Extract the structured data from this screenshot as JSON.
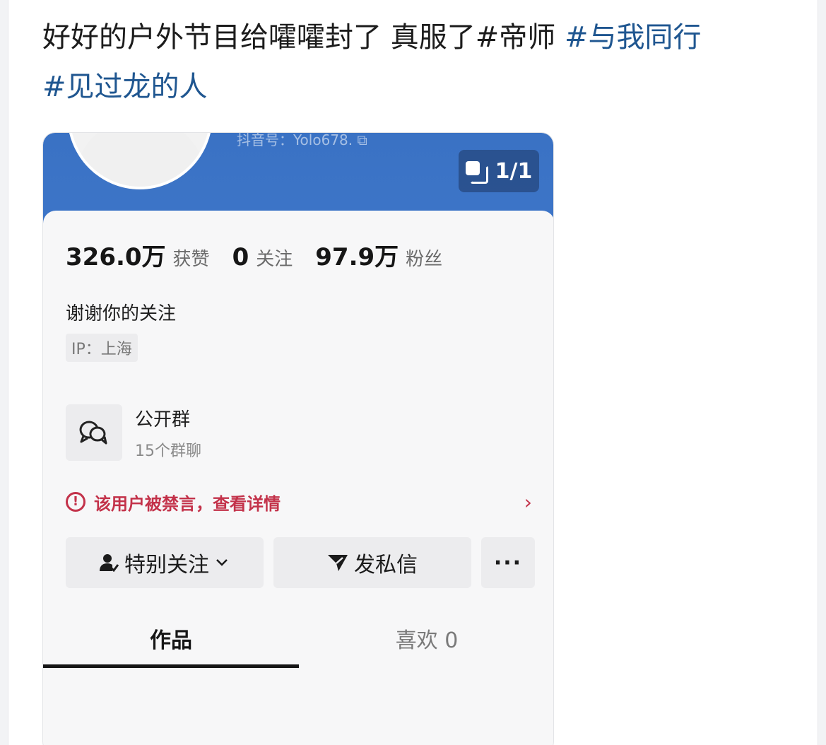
{
  "post": {
    "text_plain": "好好的户外节目给嚯嚯封了 真服了#帝师 ",
    "hashtag_1": "#与我同行",
    "hashtag_2": "#见过龙的人"
  },
  "profile": {
    "douyin_id": "抖音号：Yolo678. ⧉",
    "page_indicator": "1/1",
    "stats": {
      "likes_num": "326.0万",
      "likes_label": "获赞",
      "following_num": "0",
      "following_label": "关注",
      "followers_num": "97.9万",
      "followers_label": "粉丝"
    },
    "bio": "谢谢你的关注",
    "ip": "IP：上海",
    "group": {
      "title": "公开群",
      "subtitle": "15个群聊"
    },
    "ban_notice": "该用户被禁言，查看详情",
    "buttons": {
      "follow": "特别关注",
      "message": "发私信",
      "more": "···"
    },
    "tabs": {
      "works": "作品",
      "likes": "喜欢 0"
    }
  },
  "colors": {
    "header_blue": "#3a72c4",
    "hashtag_blue": "#1f5690",
    "warning_red": "#c3324a"
  }
}
